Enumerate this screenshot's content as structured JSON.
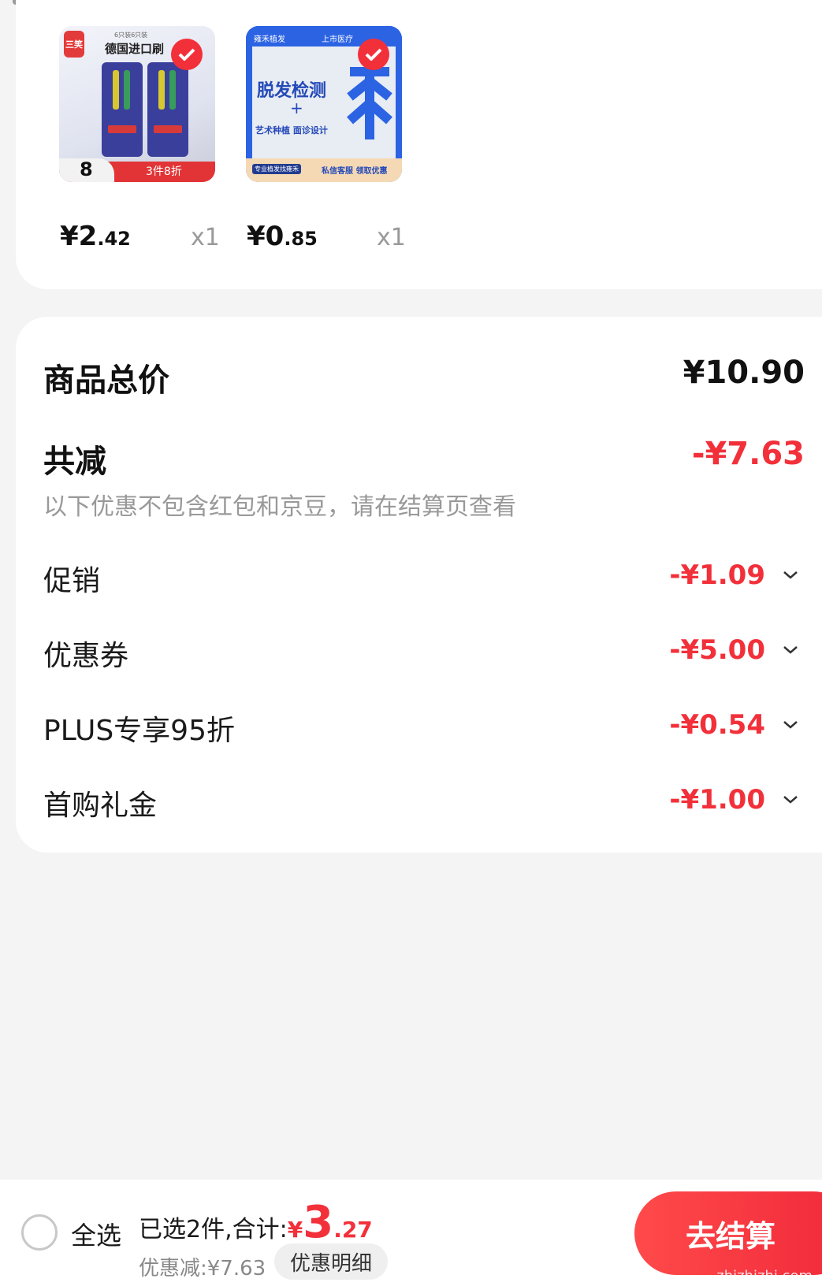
{
  "products": [
    {
      "price_int": "¥2",
      "price_dec": ".42",
      "qty": "x1",
      "image": {
        "brand": "三笑",
        "headline": "德国进口刷",
        "top_text": "6只装6只装",
        "badge_num": "8",
        "banner": "3件8折"
      }
    },
    {
      "price_int": "¥0",
      "price_dec": ".85",
      "qty": "x1",
      "image": {
        "brand": "雍禾植发",
        "top_right": "上市医疗",
        "headline": "脱发检测",
        "plus": "+",
        "subline": "艺术种植 面诊设计",
        "footer_left": "专业植发找雍禾",
        "footer_right": "私信客服 领取优惠"
      }
    }
  ],
  "summary": {
    "total_label": "商品总价",
    "total_value": "¥10.90",
    "reduce_label": "共减",
    "reduce_value": "-¥7.63",
    "note": "以下优惠不包含红包和京豆，请在结算页查看",
    "discounts": [
      {
        "label": "促销",
        "value": "-¥1.09"
      },
      {
        "label": "优惠券",
        "value": "-¥5.00"
      },
      {
        "label": "PLUS专享95折",
        "value": "-¥0.54"
      },
      {
        "label": "首购礼金",
        "value": "-¥1.00"
      }
    ]
  },
  "bottom": {
    "select_all": "全选",
    "selected_text": "已选2件,合计:",
    "total_symbol": "¥",
    "total_int": "3",
    "total_dec": ".27",
    "saved_text": "优惠减:¥7.63",
    "detail_button": "优惠明细",
    "checkout_button": "去结算",
    "watermark": "zhizhizhi.com"
  },
  "colors": {
    "accent_red": "#f2303a",
    "background": "#f4f4f4"
  }
}
